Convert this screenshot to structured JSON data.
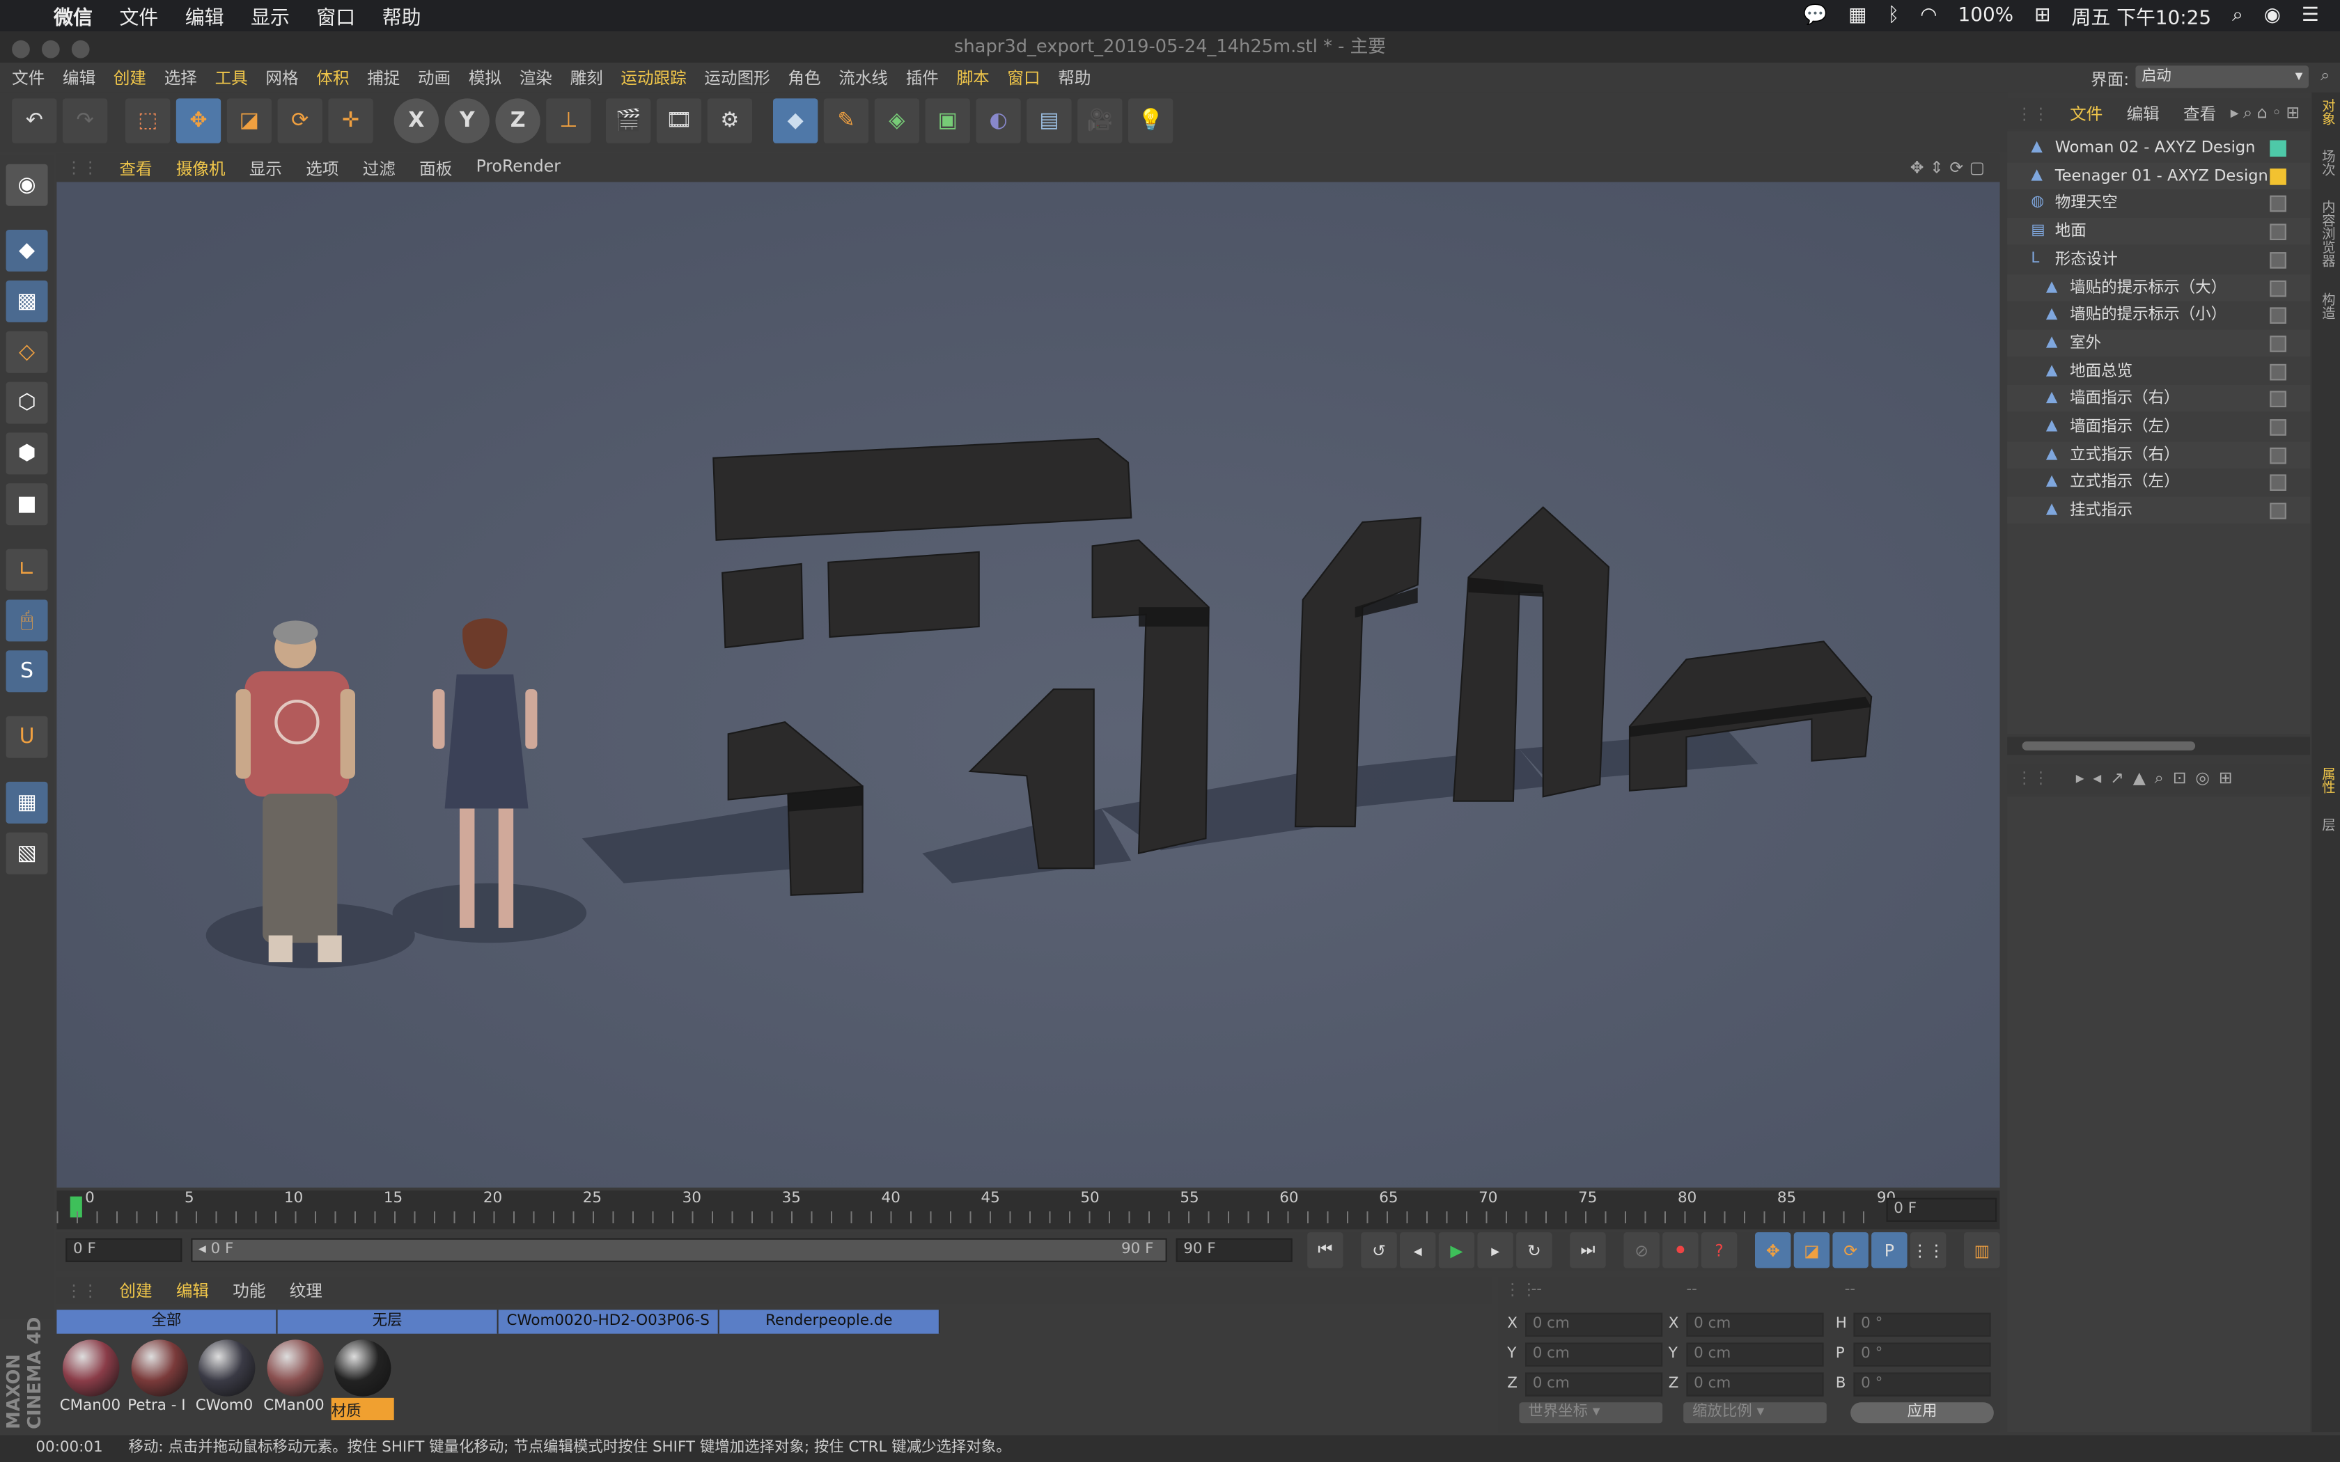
{
  "os": {
    "apple": "",
    "app": "微信",
    "menus": [
      "文件",
      "编辑",
      "显示",
      "窗口",
      "帮助"
    ],
    "battery": "100%",
    "clock": "周五 下午10:25"
  },
  "window": {
    "title": "shapr3d_export_2019-05-24_14h25m.stl * - 主要"
  },
  "app_menu": [
    {
      "label": "文件"
    },
    {
      "label": "编辑"
    },
    {
      "label": "创建",
      "hl": true
    },
    {
      "label": "选择"
    },
    {
      "label": "工具",
      "hl": true
    },
    {
      "label": "网格"
    },
    {
      "label": "体积",
      "hl": true
    },
    {
      "label": "捕捉"
    },
    {
      "label": "动画"
    },
    {
      "label": "模拟"
    },
    {
      "label": "渲染"
    },
    {
      "label": "雕刻"
    },
    {
      "label": "运动跟踪",
      "hl": true
    },
    {
      "label": "运动图形"
    },
    {
      "label": "角色"
    },
    {
      "label": "流水线"
    },
    {
      "label": "插件"
    },
    {
      "label": "脚本",
      "hl": true
    },
    {
      "label": "窗口",
      "hl": true
    },
    {
      "label": "帮助"
    }
  ],
  "interface": {
    "label": "界面:",
    "value": "启动"
  },
  "viewport_menu": [
    {
      "label": "查看",
      "hl": true
    },
    {
      "label": "摄像机",
      "hl": true
    },
    {
      "label": "显示"
    },
    {
      "label": "选项"
    },
    {
      "label": "过滤"
    },
    {
      "label": "面板"
    },
    {
      "label": "ProRender"
    }
  ],
  "toolbar": {
    "axis_x": "X",
    "axis_y": "Y",
    "axis_z": "Z"
  },
  "timeline": {
    "ticks": [
      "0",
      "5",
      "10",
      "15",
      "20",
      "25",
      "30",
      "35",
      "40",
      "45",
      "50",
      "55",
      "60",
      "65",
      "70",
      "75",
      "80",
      "85",
      "90"
    ],
    "frame_end_field": "0 F",
    "start_field": "0 F",
    "range_start": "0 F",
    "range_end": "90 F",
    "end_field": "90 F"
  },
  "material_menu": [
    {
      "label": "创建",
      "hl": true
    },
    {
      "label": "编辑",
      "hl": true
    },
    {
      "label": "功能"
    },
    {
      "label": "纹理"
    }
  ],
  "material_tabs": [
    "全部",
    "无层",
    "CWom0020-HD2-O03P06-S",
    "Renderpeople.de"
  ],
  "materials": [
    {
      "label": "CMan00",
      "color": "#8a3c48"
    },
    {
      "label": "Petra - I",
      "color": "#7a3a3a"
    },
    {
      "label": "CWom0",
      "color": "#3a3a45"
    },
    {
      "label": "CMan00",
      "color": "#8a5050"
    },
    {
      "label": "材质",
      "color": "#222222"
    }
  ],
  "coords": {
    "headers": [
      "--",
      "--",
      "--"
    ],
    "rows": [
      {
        "a": "X",
        "av": "0 cm",
        "b": "X",
        "bv": "0 cm",
        "c": "H",
        "cv": "0 °"
      },
      {
        "a": "Y",
        "av": "0 cm",
        "b": "Y",
        "bv": "0 cm",
        "c": "P",
        "cv": "0 °"
      },
      {
        "a": "Z",
        "av": "0 cm",
        "b": "Z",
        "bv": "0 cm",
        "c": "B",
        "cv": "0 °"
      }
    ],
    "mode1": "世界坐标",
    "mode2": "缩放比例",
    "apply": "应用"
  },
  "status": {
    "time": "00:00:01",
    "message": "移动: 点击并拖动鼠标移动元素。按住 SHIFT 键量化移动; 节点编辑模式时按住 SHIFT 键增加选择对象; 按住 CTRL 键减少选择对象。"
  },
  "object_menu": [
    "文件",
    "编辑",
    "查看"
  ],
  "objects": [
    {
      "name": "Woman 02 - AXYZ Design",
      "indent": 0,
      "swatch": "#4ec9a8"
    },
    {
      "name": "Teenager 01 - AXYZ Design",
      "indent": 0,
      "swatch": "#f2c230"
    },
    {
      "name": "物理天空",
      "indent": 0
    },
    {
      "name": "地面",
      "indent": 0
    },
    {
      "name": "形态设计",
      "indent": 0
    },
    {
      "name": "墙贴的提示标示（大）",
      "indent": 1
    },
    {
      "name": "墙贴的提示标示（小）",
      "indent": 1
    },
    {
      "name": "室外",
      "indent": 1
    },
    {
      "name": "地面总览",
      "indent": 1
    },
    {
      "name": "墙面指示（右）",
      "indent": 1
    },
    {
      "name": "墙面指示（左）",
      "indent": 1
    },
    {
      "name": "立式指示（右）",
      "indent": 1
    },
    {
      "name": "立式指示（左）",
      "indent": 1
    },
    {
      "name": "挂式指示",
      "indent": 1
    }
  ],
  "side_tabs": [
    "对象",
    "场次",
    "内容浏览器",
    "构造"
  ],
  "side_tabs2": [
    "属性",
    "层"
  ],
  "brand": "MAXON CINEMA 4D"
}
